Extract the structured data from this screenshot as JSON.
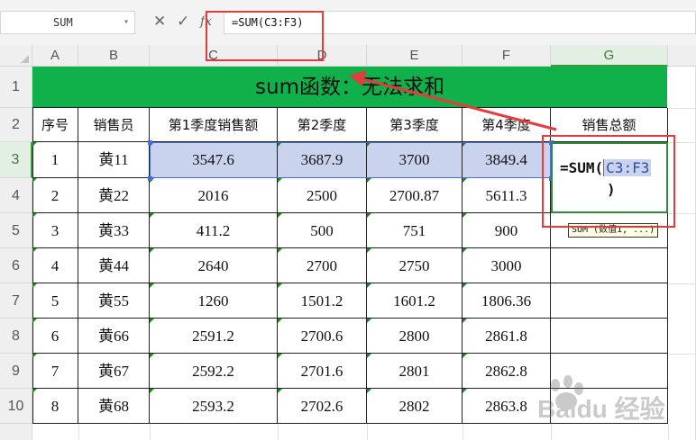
{
  "formula_bar": {
    "name_box": "SUM",
    "cancel_icon": "✕",
    "enter_icon": "✓",
    "fx_icon": "fx",
    "formula": "=SUM(C3:F3)"
  },
  "columns": [
    "A",
    "B",
    "C",
    "D",
    "E",
    "F",
    "G"
  ],
  "active_column": "G",
  "rows": [
    "1",
    "2",
    "3",
    "4",
    "5",
    "6",
    "7",
    "8",
    "9",
    "10"
  ],
  "active_row": "3",
  "sheet": {
    "title": "sum函数：无法求和",
    "title_fill": "#10b04a",
    "headers": [
      "序号",
      "销售员",
      "第1季度销售额",
      "第2季度",
      "第3季度",
      "第4季度",
      "销售总额"
    ],
    "data": [
      [
        "1",
        "黄11",
        "3547.6",
        "3687.9",
        "3700",
        "3849.4"
      ],
      [
        "2",
        "黄22",
        "2016",
        "2500",
        "2700.87",
        "5611.3"
      ],
      [
        "3",
        "黄33",
        "411.2",
        "500",
        "751",
        "900"
      ],
      [
        "4",
        "黄44",
        "2640",
        "2700",
        "2750",
        "3000"
      ],
      [
        "5",
        "黄55",
        "1260",
        "1501.2",
        "1601.2",
        "1806.36"
      ],
      [
        "6",
        "黄66",
        "2591.2",
        "2700.6",
        "2800",
        "2861.8"
      ],
      [
        "7",
        "黄67",
        "2592.2",
        "2701.6",
        "2801",
        "2862.8"
      ],
      [
        "8",
        "黄68",
        "2593.2",
        "2702.6",
        "2802",
        "2863.8"
      ]
    ]
  },
  "editor": {
    "prefix": "=SUM(",
    "reference": "C3:F3",
    "suffix": ")"
  },
  "tooltip": "SUM (数值1, ...)",
  "annotation_color": "#e53b3b",
  "selection_color": "#c9d3ee",
  "watermark": "Baidu 经验"
}
